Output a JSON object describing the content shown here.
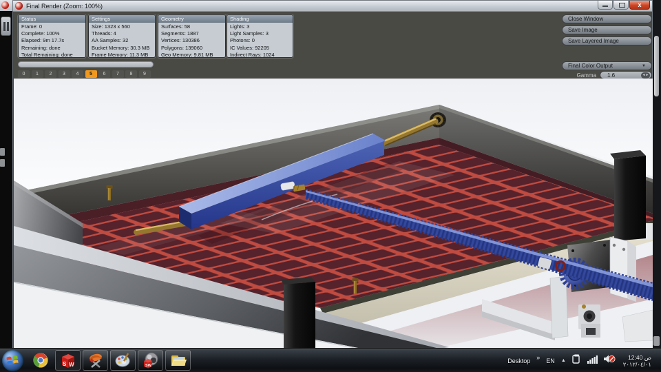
{
  "window": {
    "title": "Final Render (Zoom: 100%)",
    "icon": "photoview-render-icon",
    "controls": [
      "minimize-button",
      "maximize-button",
      "close-button"
    ]
  },
  "render_stats": {
    "panels": [
      {
        "title": "Status",
        "lines": [
          "Frame: 0",
          "Complete: 100%",
          "Elapsed: 9m 17.7s",
          "Remaining: done",
          "Total Remaining: done"
        ]
      },
      {
        "title": "Settings",
        "lines": [
          "Size: 1323 x 560",
          "Threads: 4",
          "AA Samples: 32",
          "Bucket Memory: 30.3 MB",
          "Frame Memory: 11.3 MB"
        ]
      },
      {
        "title": "Geometry",
        "lines": [
          "Surfaces: 58",
          "Segments: 1887",
          "Vertices: 130386",
          "Polygons: 139060",
          "Geo Memory: 9.81 MB"
        ]
      },
      {
        "title": "Shading",
        "lines": [
          "Lights: 3",
          "Light Samples: 3",
          "Photons: 0",
          "IC Values: 92205",
          "Indirect Rays: 1024"
        ]
      }
    ],
    "buckets": [
      "0",
      "1",
      "2",
      "3",
      "4",
      "5",
      "6",
      "7",
      "8",
      "9"
    ],
    "active_bucket_index": 5
  },
  "actions": [
    {
      "label": "Close Window",
      "name": "close-window-button"
    },
    {
      "label": "Save Image",
      "name": "save-image-button"
    },
    {
      "label": "Save Layered Image",
      "name": "save-layered-image-button"
    }
  ],
  "output_controls": {
    "mode_selected": "Final Color Output",
    "gamma_label": "Gamma",
    "gamma_value": "1.6"
  },
  "taskbar": {
    "start": "windows-start-orb",
    "apps": [
      "chrome-icon",
      "solidworks-icon",
      "image-editor-icon",
      "paint-icon",
      "photoview-icon",
      "explorer-icon"
    ],
    "desktop_label": "Desktop",
    "overflow_chevron": "»",
    "language": "EN",
    "hidden_icons_arrow": "▲",
    "tray_icons": [
      "action-center-icon",
      "network-icon",
      "volume-muted-icon"
    ],
    "clock": {
      "time": "12:40 ص",
      "date": "٢٠١٢/٠٤/٠١"
    }
  },
  "colors": {
    "bucket_active": "#f2991d",
    "panel_header": "#7f8c9a",
    "tray_red": "#bf4b41",
    "rail_blue": "#4a5fb0",
    "close_button_red": "#cf4526"
  }
}
